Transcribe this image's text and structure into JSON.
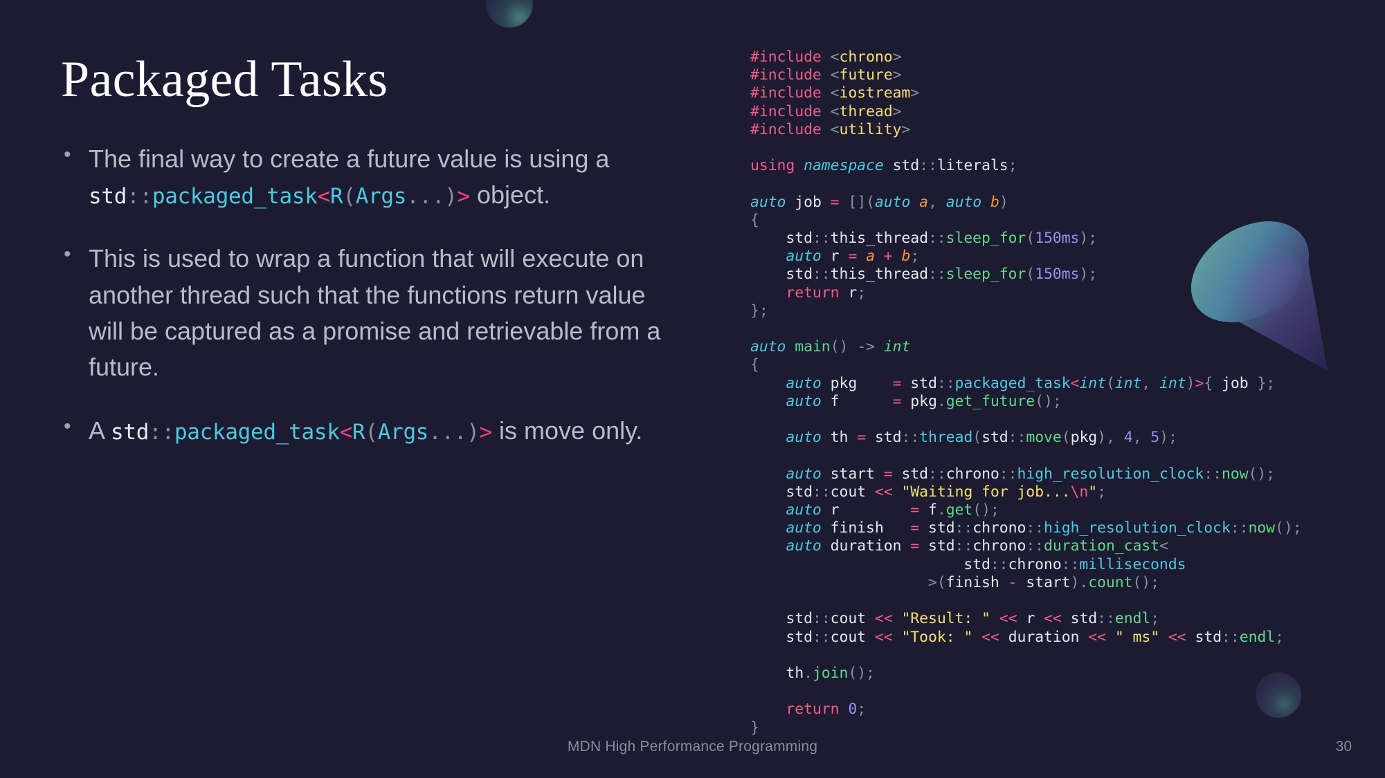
{
  "slide": {
    "title": "Packaged Tasks",
    "footer": "MDN High Performance Programming",
    "page_number": "30",
    "background_color": "#1c1b31"
  },
  "bullets": [
    {
      "id": "bullet-1",
      "text_before": "The final way to create a future value is using a ",
      "code": "std::packaged_task<R(Args...)>",
      "text_after": " object."
    },
    {
      "id": "bullet-2",
      "text_before": "This is used to wrap a function that will execute on another thread such that the functions return value will be captured as a promise and retrievable from a future.",
      "code": "",
      "text_after": ""
    },
    {
      "id": "bullet-3",
      "text_before": "A ",
      "code": "std::packaged_task<R(Args...)>",
      "text_after": " is move only."
    }
  ],
  "code": {
    "language": "cpp",
    "lines": [
      "#include <chrono>",
      "#include <future>",
      "#include <iostream>",
      "#include <thread>",
      "#include <utility>",
      "",
      "using namespace std::literals;",
      "",
      "auto job = [](auto a, auto b)",
      "{",
      "    std::this_thread::sleep_for(150ms);",
      "    auto r = a + b;",
      "    std::this_thread::sleep_for(150ms);",
      "    return r;",
      "};",
      "",
      "auto main() -> int",
      "{",
      "    auto pkg    = std::packaged_task<int(int, int)>{ job };",
      "    auto f      = pkg.get_future();",
      "",
      "    auto th = std::thread(std::move(pkg), 4, 5);",
      "",
      "    auto start = std::chrono::high_resolution_clock::now();",
      "    std::cout << \"Waiting for job...\\n\";",
      "    auto r        = f.get();",
      "    auto finish   = std::chrono::high_resolution_clock::now();",
      "    auto duration = std::chrono::duration_cast<",
      "                        std::chrono::milliseconds",
      "                    >(finish - start).count();",
      "",
      "    std::cout << \"Result: \" << r << std::endl;",
      "    std::cout << \"Took: \" << duration << \" ms\" << std::endl;",
      "",
      "    th.join();",
      "",
      "    return 0;",
      "}"
    ]
  },
  "colors": {
    "background": "#1c1b31",
    "title": "#fdfdfd",
    "body_text": "#b9bbc6",
    "footer_text": "#8a8c9b",
    "code_default": "#e6e6ee",
    "code_keyword": "#f25d86",
    "code_string": "#f3e070",
    "code_type": "#4ec9e0",
    "code_function": "#5fd98a",
    "code_number": "#9d8df1",
    "code_param": "#f0913c",
    "code_punct": "#8b8fa3"
  },
  "decorations": [
    {
      "name": "sphere-top",
      "shape": "sphere"
    },
    {
      "name": "sphere-bottom",
      "shape": "sphere"
    },
    {
      "name": "cone",
      "shape": "cone"
    }
  ]
}
